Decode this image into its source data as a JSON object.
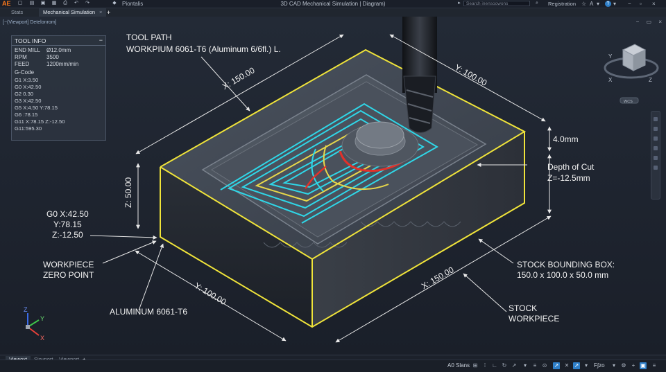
{
  "app": {
    "logo": "AE",
    "window_title": "3D CAD Mechanical Simulation | Diagram)",
    "project_label": "Piontalis",
    "search_placeholder": "Search inensoowons",
    "registration": "Registration",
    "quick_icons": [
      "new-file-icon",
      "open-folder-icon",
      "save-icon",
      "save-as-icon",
      "print-icon",
      "undo-icon",
      "redo-icon"
    ],
    "right_icons": [
      "user-icon",
      "cart-icon",
      "font-icon",
      "help-icon",
      "minimize-icon",
      "close-icon"
    ]
  },
  "tabs": [
    {
      "label": "Stats",
      "active": false
    },
    {
      "label": "Mechanical Simulation",
      "active": true,
      "close": "×"
    },
    {
      "label": "+",
      "active": false
    }
  ],
  "viewport": {
    "label": "[−(Viewport] Detelonrom]",
    "controls": [
      "−",
      "▭",
      "×"
    ],
    "viewcube": {
      "top": "TOP",
      "front": "FRONT",
      "right": "RIGHT",
      "axis_y": "Y",
      "axis_x": "X",
      "axis_z": "Z",
      "wcs": "WCS"
    }
  },
  "tool_info": {
    "title": "TOOL INFO",
    "collapse": "−",
    "rows": [
      {
        "label": "END MILL",
        "value": "Ø12.0mm"
      },
      {
        "label": "RPM",
        "value": "3500"
      },
      {
        "label": "FEED",
        "value": "1200mm/min"
      }
    ],
    "gcode_title": "G-Code",
    "gcode": [
      "G1 X:3.50",
      "G0 X:42.50",
      "G2 0.30",
      "G3 X:42.50",
      "G5 X:4.50 Y:78.15",
      "G6 :78.15",
      "G11 X:78.15 Z:-12.50",
      "G11:595.30"
    ]
  },
  "annotations": {
    "tool_path_line1": "TOOL PATH",
    "tool_path_line2": "WORKPIUM 6061-T6 (Aluminum 6/6fl.) L.",
    "dim_x_top": "X: 150.00",
    "dim_y_top": "Y: 100.00",
    "dim_z": "Z: 50.00",
    "dim_x_bottom": "X: 150.00",
    "dim_y_bottom": "Y: 100.00",
    "depth_4": "4.0mm",
    "depth_cut_line1": "Depth of Cut",
    "depth_cut_line2": "Z=-12.5mm",
    "g0_line1": "G0 X:42.50",
    "g0_line2": "Y:78.15",
    "g0_line3": "Z:-12.50",
    "zero_line1": "WORKPIECE",
    "zero_line2": "ZERO POINT",
    "aluminum": "ALUMINUM 6061-T6",
    "bbox_line1": "STOCK BOUNDING BOX:",
    "bbox_line2": "150.0 x 100.0 x 50.0 mm",
    "stock_line1": "STOCK",
    "stock_line2": "WORKPIECE",
    "ucs_x": "X",
    "ucs_y": "Y",
    "ucs_z": "Z"
  },
  "layout_tabs": [
    {
      "label": "Viewoxt",
      "active": true
    },
    {
      "label": "Siovport",
      "active": false
    },
    {
      "label": "Viewport",
      "active": false
    },
    {
      "label": "+",
      "active": false
    }
  ],
  "status": {
    "text": "A0 Slans",
    "zoom_text": "F∫zo",
    "icons": [
      "grid-icon",
      "snap-icon",
      "ortho-icon",
      "polar-icon",
      "osnap-icon",
      "otrack-icon",
      "lineweight-icon",
      "transparency-icon",
      "selection-icon",
      "annotation-icon",
      "workspace-icon",
      "isolate-icon",
      "hardware-icon",
      "clean-screen-icon",
      "customize-icon"
    ]
  },
  "colors": {
    "background": "#1e2430",
    "edge_highlight": "#f0e43a",
    "toolpath_cyan": "#2fd7e8",
    "toolpath_yellow": "#e8d84a",
    "toolpath_red": "#e2312a",
    "accent_blue": "#2e7fc9",
    "logo_orange": "#ff7a1a"
  }
}
